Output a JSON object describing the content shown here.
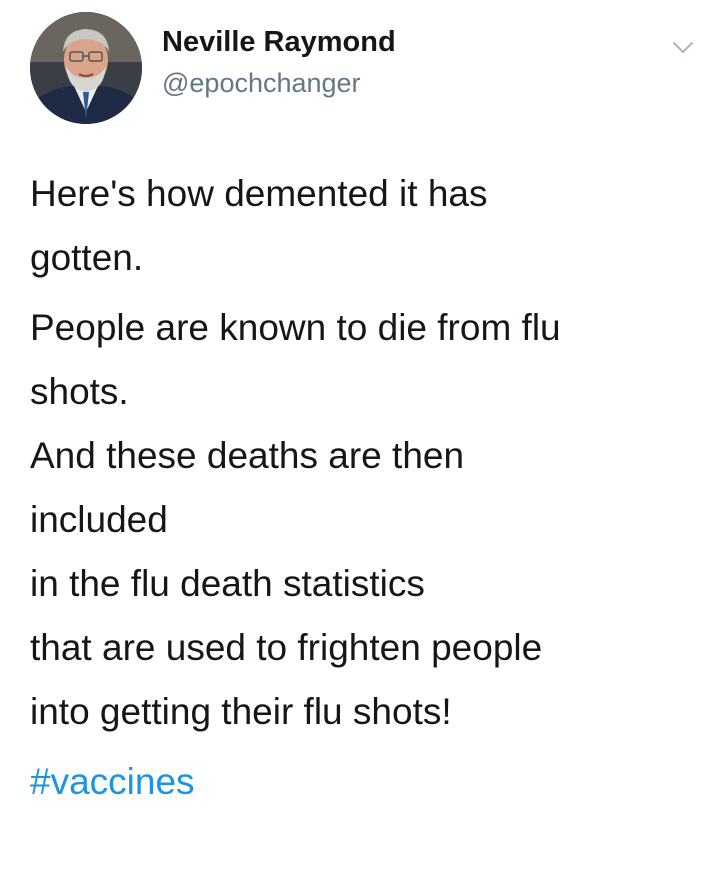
{
  "author": {
    "name": "Neville Raymond",
    "handle": "@epochchanger"
  },
  "icons": {
    "menu": "chevron-down-icon",
    "avatar": "profile-photo"
  },
  "tweet": {
    "lines_para1": [
      "Here's how demented it has",
      "gotten."
    ],
    "lines_para2": [
      "People are known to die from flu",
      "shots.",
      "And these deaths are then",
      "included",
      "in the flu death statistics",
      "that are used to frighten people",
      "into getting their flu shots!"
    ],
    "hashtag": "#vaccines"
  },
  "colors": {
    "text": "#14171a",
    "handle": "#657786",
    "link": "#1b95e0"
  }
}
